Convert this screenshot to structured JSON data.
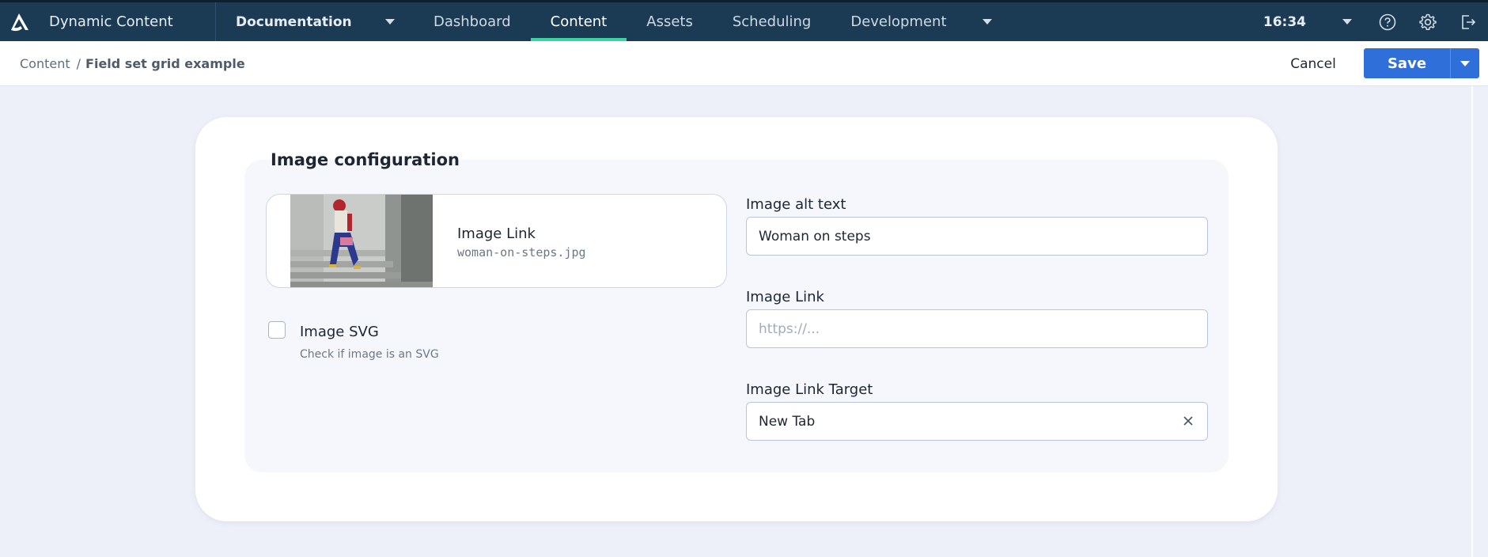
{
  "app": {
    "title": "Dynamic Content"
  },
  "hub": {
    "label": "Documentation"
  },
  "nav": {
    "items": [
      {
        "label": "Dashboard"
      },
      {
        "label": "Content"
      },
      {
        "label": "Assets"
      },
      {
        "label": "Scheduling"
      },
      {
        "label": "Development"
      }
    ],
    "active": "Content"
  },
  "clock": "16:34",
  "breadcrumb": {
    "root": "Content",
    "separator": "/",
    "current": "Field set grid example"
  },
  "actions": {
    "cancel": "Cancel",
    "save": "Save"
  },
  "fieldset": {
    "legend": "Image configuration",
    "media": {
      "title": "Image Link",
      "filename": "woman-on-steps.jpg"
    },
    "svg_checkbox": {
      "label": "Image SVG",
      "help": "Check if image is an SVG",
      "checked": false
    },
    "alt_text": {
      "label": "Image alt text",
      "value": "Woman on steps"
    },
    "image_link": {
      "label": "Image Link",
      "value": "",
      "placeholder": "https://..."
    },
    "link_target": {
      "label": "Image Link Target",
      "value": "New Tab"
    }
  },
  "colors": {
    "nav_bg": "#1b3b55",
    "active_tab": "#3bd5a2",
    "primary": "#2f6fd9",
    "page_bg": "#eef0f9"
  },
  "icons": [
    "amplience-logo-icon",
    "chevron-down-icon",
    "help-icon",
    "gear-icon",
    "logout-icon",
    "close-icon"
  ]
}
